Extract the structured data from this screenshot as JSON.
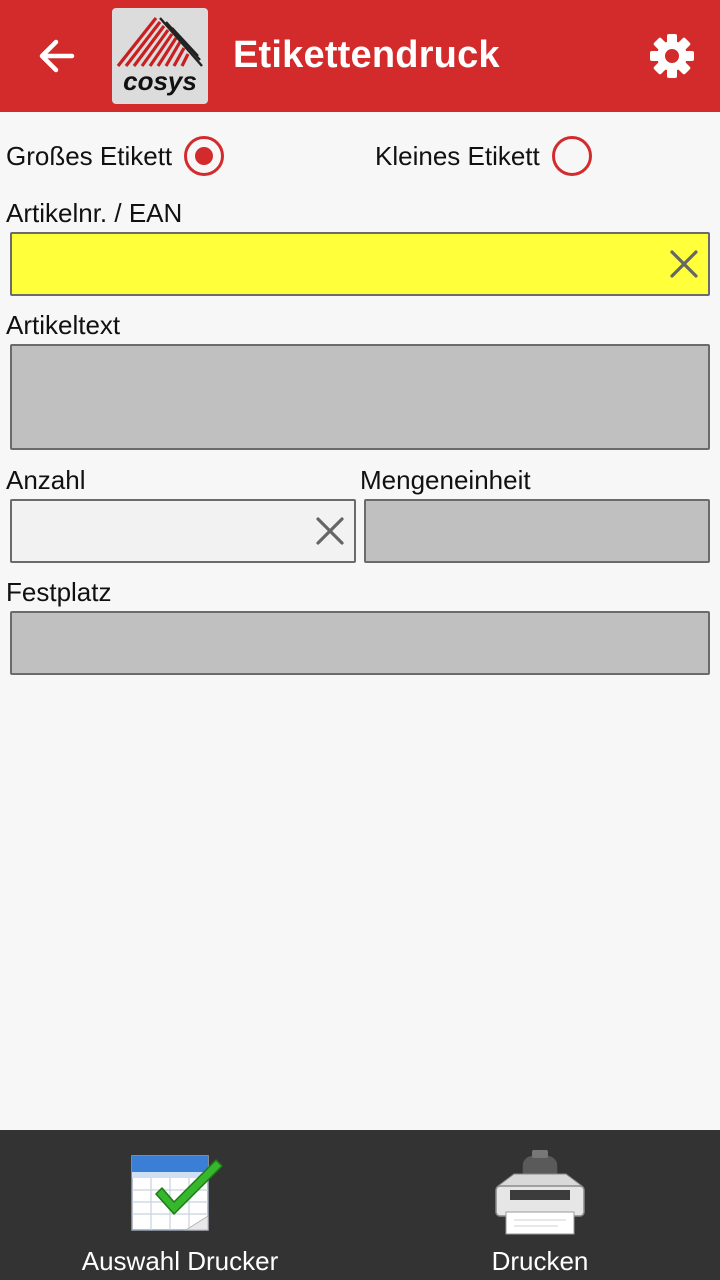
{
  "appbar": {
    "title": "Etikettendruck",
    "back_icon": "arrow-back-icon",
    "settings_icon": "gear-icon",
    "logo_text": "cosys",
    "color": "#d32b2b"
  },
  "label_size": {
    "options": [
      {
        "label": "Großes Etikett",
        "checked": true
      },
      {
        "label": "Kleines Etikett",
        "checked": false
      }
    ]
  },
  "fields": {
    "article_nr": {
      "label": "Artikelnr. / EAN",
      "value": "",
      "color": "#ffff3a"
    },
    "article_text": {
      "label": "Artikeltext",
      "value": ""
    },
    "quantity": {
      "label": "Anzahl",
      "value": ""
    },
    "unit": {
      "label": "Mengeneinheit",
      "value": ""
    },
    "location": {
      "label": "Festplatz",
      "value": ""
    }
  },
  "bottom_bar": {
    "select_printer_label": "Auswahl Drucker",
    "select_printer_icon": "table-checkmark-icon",
    "print_label": "Drucken",
    "print_icon": "printer-icon"
  }
}
